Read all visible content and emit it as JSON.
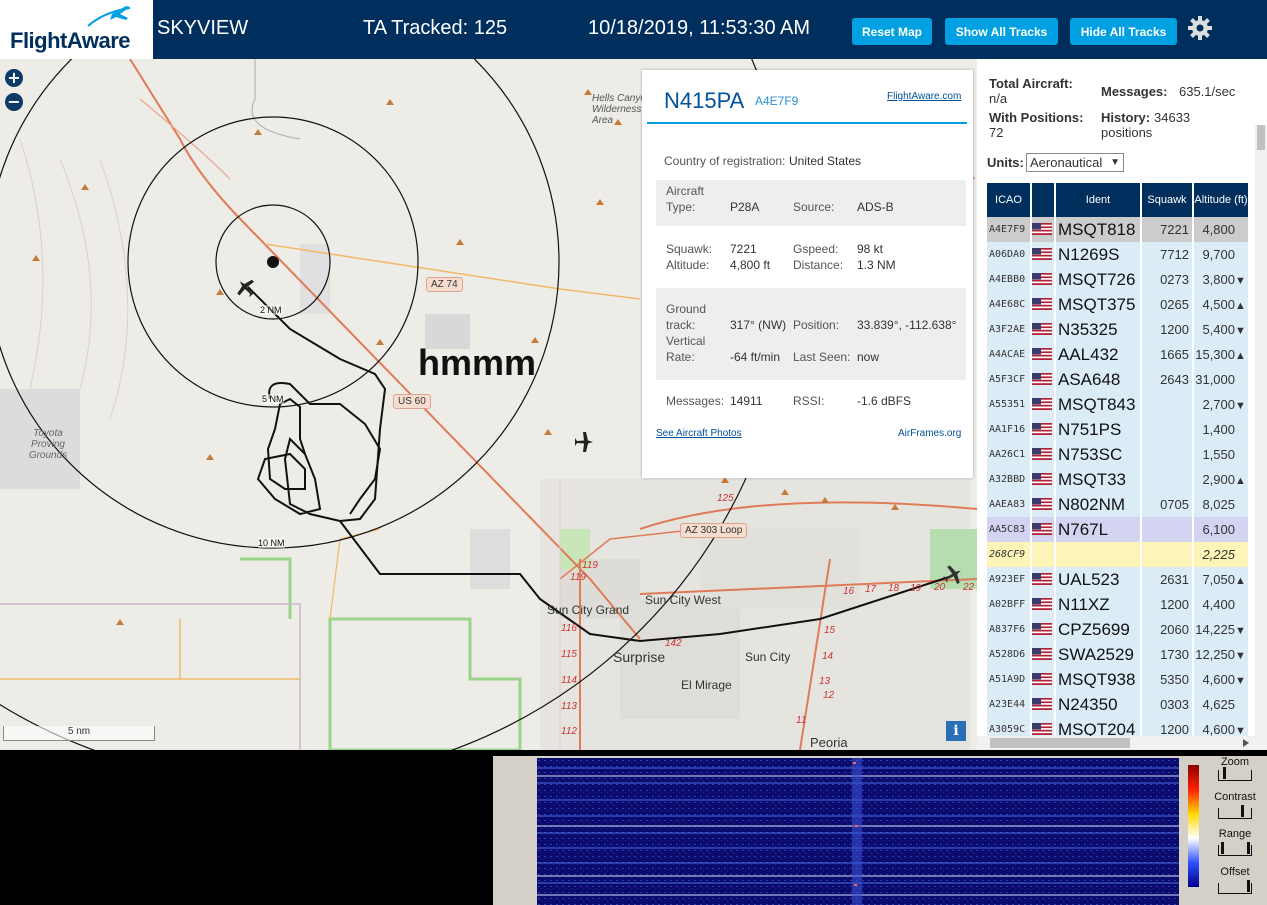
{
  "header": {
    "logo_text": "FlightAware",
    "app_name": "SKYVIEW",
    "tracked_label": "TA Tracked: 125",
    "datetime": "10/18/2019, 11:53:30 AM",
    "buttons": {
      "reset": "Reset Map",
      "show_all": "Show All Tracks",
      "hide_all": "Hide All Tracks"
    },
    "settings_icon": "gear-icon"
  },
  "map": {
    "annotation": "hmmm",
    "scale_label": "5 nm",
    "rings": [
      "2 NM",
      "5 NM",
      "10 NM"
    ],
    "roads": [
      "AZ 74",
      "US 60",
      "AZ 303 Loop"
    ],
    "places": {
      "hells_canyon": "Hells Canyon Wilderness Area",
      "toyota": "Toyota Proving Grounds",
      "sun_city_grand": "Sun City Grand",
      "sun_city_west": "Sun City West",
      "surprise": "Surprise",
      "sun_city": "Sun City",
      "el_mirage": "El Mirage",
      "peoria": "Peoria"
    },
    "exit_numbers": [
      "125",
      "119",
      "119",
      "116",
      "115",
      "114",
      "113",
      "112",
      "142",
      "16",
      "17",
      "18",
      "19",
      "20",
      "22",
      "15",
      "14",
      "13",
      "12",
      "11"
    ],
    "info_label": "i"
  },
  "popup": {
    "registration": "N415PA",
    "hex": "A4E7F9",
    "fa_link": "FlightAware.com",
    "country_label": "Country of registration:",
    "country": "United States",
    "aircraft_type_label": "Aircraft Type:",
    "aircraft_type": "P28A",
    "source_label": "Source:",
    "source": "ADS-B",
    "squawk_label": "Squawk:",
    "squawk": "7221",
    "gspeed_label": "Gspeed:",
    "gspeed": "98 kt",
    "altitude_label": "Altitude:",
    "altitude": "4,800 ft",
    "distance_label": "Distance:",
    "distance": "1.3 NM",
    "ground_track_label": "Ground track:",
    "ground_track": "317° (NW)",
    "position_label": "Position:",
    "position": "33.839°, -112.638°",
    "vertical_rate_label": "Vertical Rate:",
    "vertical_rate": "-64 ft/min",
    "last_seen_label": "Last Seen:",
    "last_seen": "now",
    "messages_label": "Messages:",
    "messages": "14911",
    "rssi_label": "RSSI:",
    "rssi": "-1.6 dBFS",
    "photos_link": "See Aircraft Photos",
    "airframes_link": "AirFrames.org"
  },
  "sidebar": {
    "total_aircraft_label": "Total Aircraft:",
    "total_aircraft": "n/a",
    "with_positions_label": "With Positions:",
    "with_positions": "72",
    "messages_label": "Messages:",
    "messages": "635.1/sec",
    "history_label": "History:",
    "history": "34633 positions",
    "units_label": "Units:",
    "units_value": "Aeronautical",
    "columns": [
      "ICAO",
      "",
      "Ident",
      "Squawk",
      "Altitude (ft)"
    ],
    "rows": [
      {
        "icao": "A4E7F9",
        "flag": true,
        "ident": "MSQT818",
        "squawk": "7221",
        "alt": "4,800",
        "trend": "",
        "style": "sel"
      },
      {
        "icao": "A06DA0",
        "flag": true,
        "ident": "N1269S",
        "squawk": "7712",
        "alt": "9,700",
        "trend": "",
        "style": "r"
      },
      {
        "icao": "A4EBB0",
        "flag": true,
        "ident": "MSQT726",
        "squawk": "0273",
        "alt": "3,800",
        "trend": "▼",
        "style": "r"
      },
      {
        "icao": "A4E68C",
        "flag": true,
        "ident": "MSQT375",
        "squawk": "0265",
        "alt": "4,500",
        "trend": "▲",
        "style": "r"
      },
      {
        "icao": "A3F2AE",
        "flag": true,
        "ident": "N35325",
        "squawk": "1200",
        "alt": "5,400",
        "trend": "▼",
        "style": "r"
      },
      {
        "icao": "A4ACAE",
        "flag": true,
        "ident": "AAL432",
        "squawk": "1665",
        "alt": "15,300",
        "trend": "▲",
        "style": "r"
      },
      {
        "icao": "A5F3CF",
        "flag": true,
        "ident": "ASA648",
        "squawk": "2643",
        "alt": "31,000",
        "trend": "",
        "style": "r"
      },
      {
        "icao": "A55351",
        "flag": true,
        "ident": "MSQT843",
        "squawk": "",
        "alt": "2,700",
        "trend": "▼",
        "style": "r"
      },
      {
        "icao": "AA1F16",
        "flag": true,
        "ident": "N751PS",
        "squawk": "",
        "alt": "1,400",
        "trend": "",
        "style": "r"
      },
      {
        "icao": "AA26C1",
        "flag": true,
        "ident": "N753SC",
        "squawk": "",
        "alt": "1,550",
        "trend": "",
        "style": "r"
      },
      {
        "icao": "A32BBD",
        "flag": true,
        "ident": "MSQT33",
        "squawk": "",
        "alt": "2,900",
        "trend": "▲",
        "style": "r"
      },
      {
        "icao": "AAEA83",
        "flag": true,
        "ident": "N802NM",
        "squawk": "0705",
        "alt": "8,025",
        "trend": "",
        "style": "r"
      },
      {
        "icao": "AA5C83",
        "flag": true,
        "ident": "N767L",
        "squawk": "",
        "alt": "6,100",
        "trend": "",
        "style": "hl"
      },
      {
        "icao": "268CF9",
        "flag": false,
        "ident": "",
        "squawk": "",
        "alt": "2,225",
        "trend": "",
        "style": "yl"
      },
      {
        "icao": "A923EF",
        "flag": true,
        "ident": "UAL523",
        "squawk": "2631",
        "alt": "7,050",
        "trend": "▲",
        "style": "r"
      },
      {
        "icao": "A02BFF",
        "flag": true,
        "ident": "N11XZ",
        "squawk": "1200",
        "alt": "4,400",
        "trend": "",
        "style": "r"
      },
      {
        "icao": "A837F6",
        "flag": true,
        "ident": "CPZ5699",
        "squawk": "2060",
        "alt": "14,225",
        "trend": "▼",
        "style": "r"
      },
      {
        "icao": "A528D6",
        "flag": true,
        "ident": "SWA2529",
        "squawk": "1730",
        "alt": "12,250",
        "trend": "▼",
        "style": "r"
      },
      {
        "icao": "A51A9D",
        "flag": true,
        "ident": "MSQT938",
        "squawk": "5350",
        "alt": "4,600",
        "trend": "▼",
        "style": "r"
      },
      {
        "icao": "A23E44",
        "flag": true,
        "ident": "N24350",
        "squawk": "0303",
        "alt": "4,625",
        "trend": "",
        "style": "r"
      },
      {
        "icao": "A3059C",
        "flag": true,
        "ident": "MSQT204",
        "squawk": "1200",
        "alt": "4,600",
        "trend": "▼",
        "style": "r"
      }
    ]
  },
  "waterfall_controls": {
    "zoom": "Zoom",
    "contrast": "Contrast",
    "range": "Range",
    "offset": "Offset"
  }
}
